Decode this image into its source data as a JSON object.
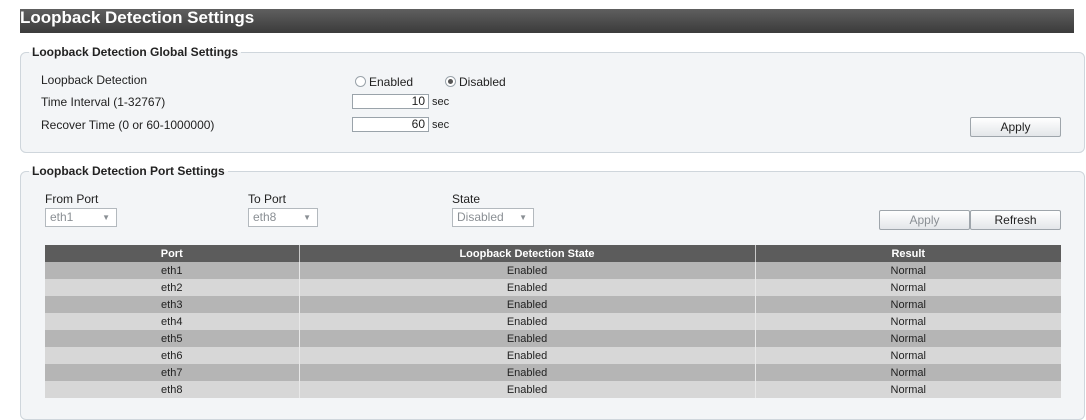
{
  "page": {
    "title": "Loopback Detection Settings"
  },
  "global": {
    "legend": "Loopback Detection Global Settings",
    "loopback_label": "Loopback Detection",
    "enabled_label": "Enabled",
    "disabled_label": "Disabled",
    "selected": "Disabled",
    "interval_label": "Time Interval (1-32767)",
    "interval_value": "10",
    "interval_unit": "sec",
    "recover_label": "Recover Time (0 or 60-1000000)",
    "recover_value": "60",
    "recover_unit": "sec",
    "apply_label": "Apply"
  },
  "port": {
    "legend": "Loopback Detection Port Settings",
    "from_label": "From Port",
    "from_value": "eth1",
    "to_label": "To Port",
    "to_value": "eth8",
    "state_label": "State",
    "state_value": "Disabled",
    "apply_label": "Apply",
    "refresh_label": "Refresh"
  },
  "table": {
    "headers": [
      "Port",
      "Loopback Detection State",
      "Result"
    ],
    "rows": [
      [
        "eth1",
        "Enabled",
        "Normal"
      ],
      [
        "eth2",
        "Enabled",
        "Normal"
      ],
      [
        "eth3",
        "Enabled",
        "Normal"
      ],
      [
        "eth4",
        "Enabled",
        "Normal"
      ],
      [
        "eth5",
        "Enabled",
        "Normal"
      ],
      [
        "eth6",
        "Enabled",
        "Normal"
      ],
      [
        "eth7",
        "Enabled",
        "Normal"
      ],
      [
        "eth8",
        "Enabled",
        "Normal"
      ]
    ]
  },
  "colors": {
    "title_bar": "#4a4a4a",
    "table_header": "#5c5c5c",
    "row_odd": "#b5b5b5",
    "row_even": "#d7d7d7"
  }
}
